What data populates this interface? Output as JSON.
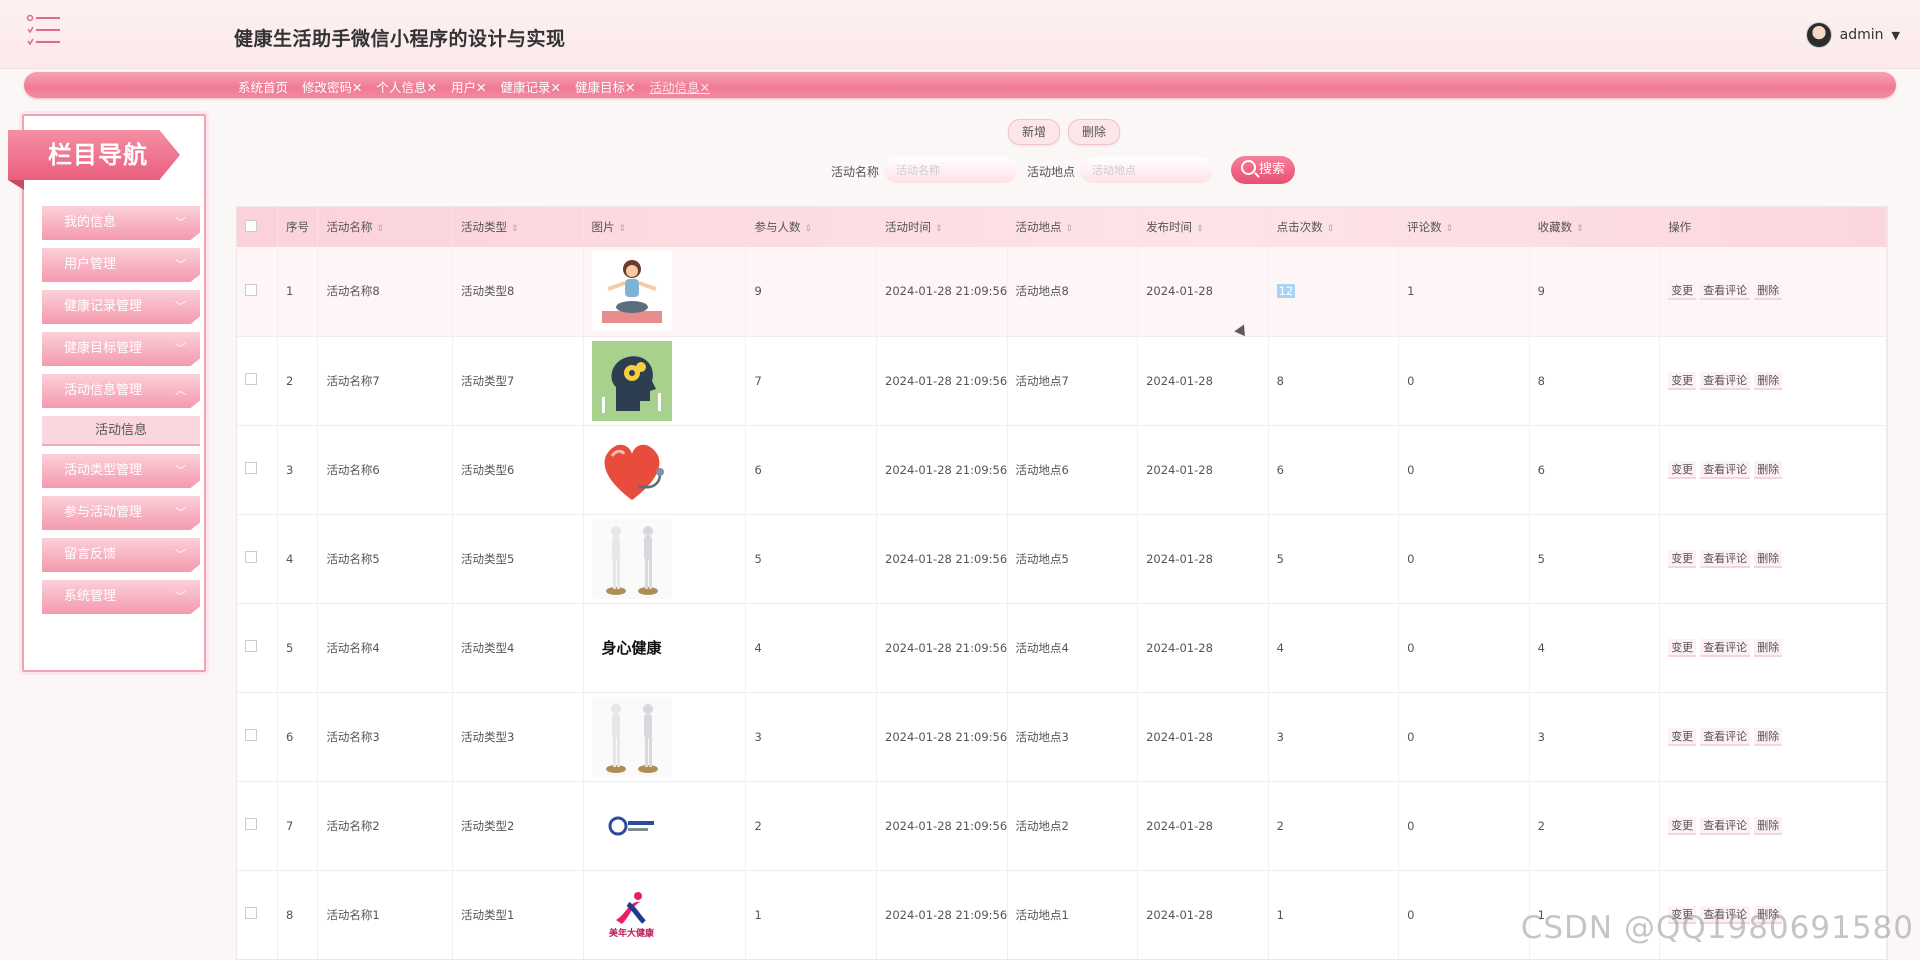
{
  "header": {
    "title": "健康生活助手微信小程序的设计与实现",
    "user": "admin"
  },
  "tabs": [
    {
      "label": "系统首页"
    },
    {
      "label": "修改密码✕"
    },
    {
      "label": "个人信息✕"
    },
    {
      "label": "用户✕"
    },
    {
      "label": "健康记录✕"
    },
    {
      "label": "健康目标✕"
    },
    {
      "label": "活动信息✕"
    }
  ],
  "sidebar": {
    "title": "栏目导航",
    "items": [
      {
        "label": "我的信息"
      },
      {
        "label": "用户管理"
      },
      {
        "label": "健康记录管理"
      },
      {
        "label": "健康目标管理"
      },
      {
        "label": "活动信息管理"
      },
      {
        "label": "活动类型管理"
      },
      {
        "label": "参与活动管理"
      },
      {
        "label": "留言反馈"
      },
      {
        "label": "系统管理"
      }
    ],
    "sub_item": "活动信息"
  },
  "toolbar": {
    "add": "新增",
    "delete": "删除",
    "name_label": "活动名称",
    "name_placeholder": "活动名称",
    "place_label": "活动地点",
    "place_placeholder": "活动地点",
    "search": "搜索"
  },
  "table": {
    "columns": [
      "序号",
      "活动名称",
      "活动类型",
      "图片",
      "参与人数",
      "活动时间",
      "活动地点",
      "发布时间",
      "点击次数",
      "评论数",
      "收藏数",
      "操作"
    ],
    "actions": [
      "变更",
      "查看评论",
      "删除"
    ],
    "rows": [
      {
        "no": "1",
        "name": "活动名称8",
        "type": "活动类型8",
        "img": "yoga",
        "count": "9",
        "time": "2024-01-28 21:09:56",
        "place": "活动地点8",
        "pub": "2024-01-28",
        "clicks": "12",
        "comments": "1",
        "favs": "9"
      },
      {
        "no": "2",
        "name": "活动名称7",
        "type": "活动类型7",
        "img": "mind",
        "count": "7",
        "time": "2024-01-28 21:09:56",
        "place": "活动地点7",
        "pub": "2024-01-28",
        "clicks": "8",
        "comments": "0",
        "favs": "8"
      },
      {
        "no": "3",
        "name": "活动名称6",
        "type": "活动类型6",
        "img": "heart",
        "count": "6",
        "time": "2024-01-28 21:09:56",
        "place": "活动地点6",
        "pub": "2024-01-28",
        "clicks": "6",
        "comments": "0",
        "favs": "6"
      },
      {
        "no": "4",
        "name": "活动名称5",
        "type": "活动类型5",
        "img": "mannequin",
        "count": "5",
        "time": "2024-01-28 21:09:56",
        "place": "活动地点5",
        "pub": "2024-01-28",
        "clicks": "5",
        "comments": "0",
        "favs": "5"
      },
      {
        "no": "5",
        "name": "活动名称4",
        "type": "活动类型4",
        "img": "calligraphy",
        "img_text": "身心健康",
        "count": "4",
        "time": "2024-01-28 21:09:56",
        "place": "活动地点4",
        "pub": "2024-01-28",
        "clicks": "4",
        "comments": "0",
        "favs": "4"
      },
      {
        "no": "6",
        "name": "活动名称3",
        "type": "活动类型3",
        "img": "mannequin",
        "count": "3",
        "time": "2024-01-28 21:09:56",
        "place": "活动地点3",
        "pub": "2024-01-28",
        "clicks": "3",
        "comments": "0",
        "favs": "3"
      },
      {
        "no": "7",
        "name": "活动名称2",
        "type": "活动类型2",
        "img": "logo",
        "count": "2",
        "time": "2024-01-28 21:09:56",
        "place": "活动地点2",
        "pub": "2024-01-28",
        "clicks": "2",
        "comments": "0",
        "favs": "2"
      },
      {
        "no": "8",
        "name": "活动名称1",
        "type": "活动类型1",
        "img": "health100",
        "img_text": "美年大健康",
        "count": "1",
        "time": "2024-01-28 21:09:56",
        "place": "活动地点1",
        "pub": "2024-01-28",
        "clicks": "1",
        "comments": "0",
        "favs": "1"
      }
    ]
  },
  "watermark": "CSDN @QQ1980691580",
  "colors": {
    "accent": "#f07a93",
    "accent_dark": "#e84f72",
    "light": "#fde6ea"
  }
}
